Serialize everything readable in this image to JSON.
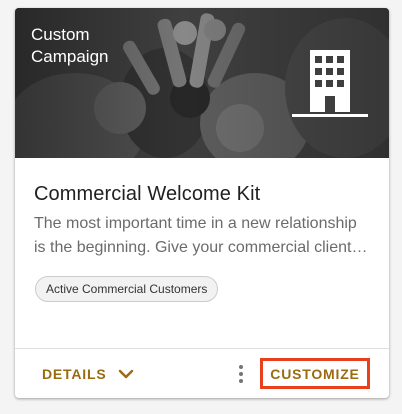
{
  "card": {
    "hero": {
      "title_line1": "Custom",
      "title_line2": "Campaign",
      "icon": "building-icon"
    },
    "title": "Commercial Welcome Kit",
    "description": {
      "line1": "The most important time in a new relationship",
      "line2": "is the beginning. Give your commercial client…"
    },
    "tag": "Active Commercial Customers",
    "actions": {
      "details_label": "DETAILS",
      "details_icon": "chevron-down-icon",
      "more_icon": "more-vert-icon",
      "customize_label": "CUSTOMIZE"
    }
  },
  "colors": {
    "accent_text": "#9a6b10",
    "highlight_border": "#e8401c",
    "title_text": "#212121",
    "body_text": "#6b6b6b"
  }
}
